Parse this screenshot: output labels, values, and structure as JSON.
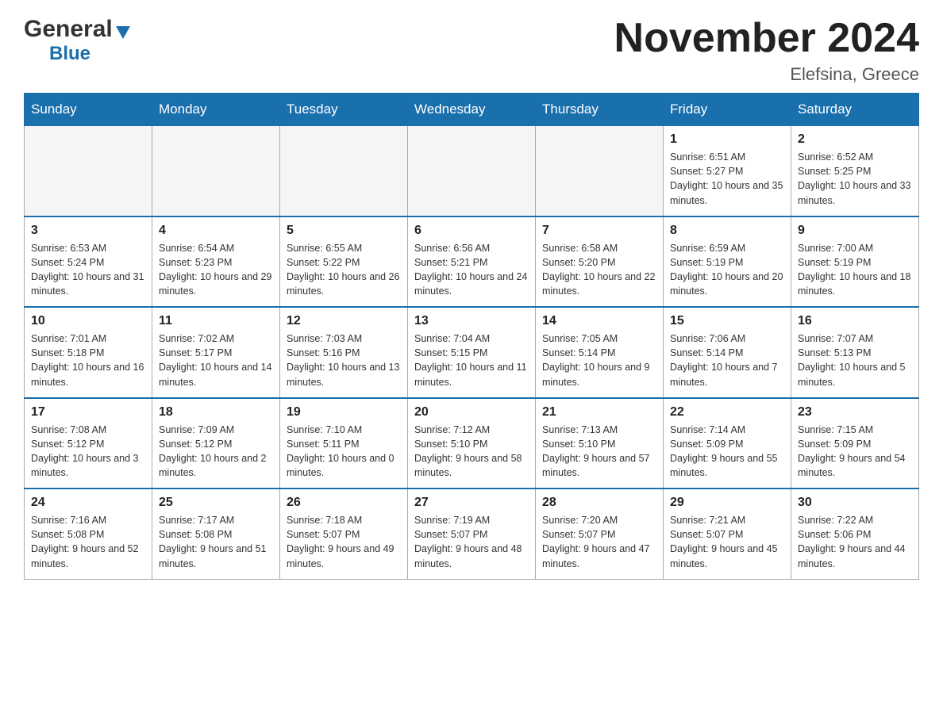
{
  "logo": {
    "general": "General",
    "blue": "Blue",
    "triangle": "▲"
  },
  "title": {
    "month_year": "November 2024",
    "location": "Elefsina, Greece"
  },
  "days_of_week": [
    "Sunday",
    "Monday",
    "Tuesday",
    "Wednesday",
    "Thursday",
    "Friday",
    "Saturday"
  ],
  "weeks": [
    {
      "days": [
        {
          "number": "",
          "info": ""
        },
        {
          "number": "",
          "info": ""
        },
        {
          "number": "",
          "info": ""
        },
        {
          "number": "",
          "info": ""
        },
        {
          "number": "",
          "info": ""
        },
        {
          "number": "1",
          "info": "Sunrise: 6:51 AM\nSunset: 5:27 PM\nDaylight: 10 hours and 35 minutes."
        },
        {
          "number": "2",
          "info": "Sunrise: 6:52 AM\nSunset: 5:25 PM\nDaylight: 10 hours and 33 minutes."
        }
      ]
    },
    {
      "days": [
        {
          "number": "3",
          "info": "Sunrise: 6:53 AM\nSunset: 5:24 PM\nDaylight: 10 hours and 31 minutes."
        },
        {
          "number": "4",
          "info": "Sunrise: 6:54 AM\nSunset: 5:23 PM\nDaylight: 10 hours and 29 minutes."
        },
        {
          "number": "5",
          "info": "Sunrise: 6:55 AM\nSunset: 5:22 PM\nDaylight: 10 hours and 26 minutes."
        },
        {
          "number": "6",
          "info": "Sunrise: 6:56 AM\nSunset: 5:21 PM\nDaylight: 10 hours and 24 minutes."
        },
        {
          "number": "7",
          "info": "Sunrise: 6:58 AM\nSunset: 5:20 PM\nDaylight: 10 hours and 22 minutes."
        },
        {
          "number": "8",
          "info": "Sunrise: 6:59 AM\nSunset: 5:19 PM\nDaylight: 10 hours and 20 minutes."
        },
        {
          "number": "9",
          "info": "Sunrise: 7:00 AM\nSunset: 5:19 PM\nDaylight: 10 hours and 18 minutes."
        }
      ]
    },
    {
      "days": [
        {
          "number": "10",
          "info": "Sunrise: 7:01 AM\nSunset: 5:18 PM\nDaylight: 10 hours and 16 minutes."
        },
        {
          "number": "11",
          "info": "Sunrise: 7:02 AM\nSunset: 5:17 PM\nDaylight: 10 hours and 14 minutes."
        },
        {
          "number": "12",
          "info": "Sunrise: 7:03 AM\nSunset: 5:16 PM\nDaylight: 10 hours and 13 minutes."
        },
        {
          "number": "13",
          "info": "Sunrise: 7:04 AM\nSunset: 5:15 PM\nDaylight: 10 hours and 11 minutes."
        },
        {
          "number": "14",
          "info": "Sunrise: 7:05 AM\nSunset: 5:14 PM\nDaylight: 10 hours and 9 minutes."
        },
        {
          "number": "15",
          "info": "Sunrise: 7:06 AM\nSunset: 5:14 PM\nDaylight: 10 hours and 7 minutes."
        },
        {
          "number": "16",
          "info": "Sunrise: 7:07 AM\nSunset: 5:13 PM\nDaylight: 10 hours and 5 minutes."
        }
      ]
    },
    {
      "days": [
        {
          "number": "17",
          "info": "Sunrise: 7:08 AM\nSunset: 5:12 PM\nDaylight: 10 hours and 3 minutes."
        },
        {
          "number": "18",
          "info": "Sunrise: 7:09 AM\nSunset: 5:12 PM\nDaylight: 10 hours and 2 minutes."
        },
        {
          "number": "19",
          "info": "Sunrise: 7:10 AM\nSunset: 5:11 PM\nDaylight: 10 hours and 0 minutes."
        },
        {
          "number": "20",
          "info": "Sunrise: 7:12 AM\nSunset: 5:10 PM\nDaylight: 9 hours and 58 minutes."
        },
        {
          "number": "21",
          "info": "Sunrise: 7:13 AM\nSunset: 5:10 PM\nDaylight: 9 hours and 57 minutes."
        },
        {
          "number": "22",
          "info": "Sunrise: 7:14 AM\nSunset: 5:09 PM\nDaylight: 9 hours and 55 minutes."
        },
        {
          "number": "23",
          "info": "Sunrise: 7:15 AM\nSunset: 5:09 PM\nDaylight: 9 hours and 54 minutes."
        }
      ]
    },
    {
      "days": [
        {
          "number": "24",
          "info": "Sunrise: 7:16 AM\nSunset: 5:08 PM\nDaylight: 9 hours and 52 minutes."
        },
        {
          "number": "25",
          "info": "Sunrise: 7:17 AM\nSunset: 5:08 PM\nDaylight: 9 hours and 51 minutes."
        },
        {
          "number": "26",
          "info": "Sunrise: 7:18 AM\nSunset: 5:07 PM\nDaylight: 9 hours and 49 minutes."
        },
        {
          "number": "27",
          "info": "Sunrise: 7:19 AM\nSunset: 5:07 PM\nDaylight: 9 hours and 48 minutes."
        },
        {
          "number": "28",
          "info": "Sunrise: 7:20 AM\nSunset: 5:07 PM\nDaylight: 9 hours and 47 minutes."
        },
        {
          "number": "29",
          "info": "Sunrise: 7:21 AM\nSunset: 5:07 PM\nDaylight: 9 hours and 45 minutes."
        },
        {
          "number": "30",
          "info": "Sunrise: 7:22 AM\nSunset: 5:06 PM\nDaylight: 9 hours and 44 minutes."
        }
      ]
    }
  ]
}
